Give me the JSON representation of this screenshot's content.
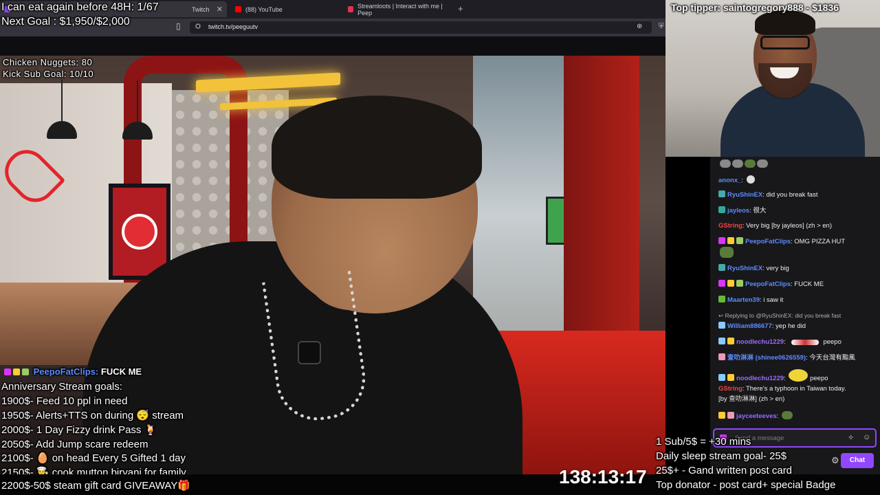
{
  "browser": {
    "tabs": [
      {
        "label": "Twitch",
        "active": true
      },
      {
        "label": "(88) YouTube",
        "active": false
      },
      {
        "label": "Streamloots | Interact with me | Peep",
        "active": false
      }
    ],
    "url": "twitch.tv/peeguutv",
    "icons": [
      "back-icon",
      "reload-icon",
      "bookmark-icon",
      "zoom-icon",
      "shield-icon"
    ]
  },
  "overlay": {
    "eat_again": "I can eat again before 48H: 1/67",
    "next_goal": "Next Goal : $1,950/$2,000",
    "chicken_nuggets": "Chicken Nuggets: 80",
    "kick_sub_goal": "Kick Sub Goal: 10/10",
    "top_tipper": "Top tipper: saintogregory888 - $1836",
    "alert_user": "PeepoFatClips:",
    "alert_message": "FUCK ME",
    "goals_title": "Anniversary Stream goals:",
    "goals": [
      "1900$- Feed 10 ppl in need",
      "1950$- Alerts+TTS on during 😴 stream",
      "2000$- 1 Day Fizzy drink Pass 🍹",
      "2050$- Add Jump scare redeem",
      "2100$- 🥚 on head Every 5 Gifted 1 day",
      "2150$- 👨‍🍳 cook mutton biryani for family",
      "2200$-50$ steam gift card GIVEAWAY🎁"
    ],
    "sub_rules": [
      "1 Sub/5$ = +30 mins",
      "Daily sleep stream goal- 25$",
      "25$+ - Gand written post card",
      "Top donator - post card+ special Badge"
    ],
    "timer": "138:13:17"
  },
  "chat": {
    "messages": [
      {
        "user": "anonx_",
        "user_color": "#5b8cff",
        "text": ""
      },
      {
        "user": "RyuShinEX",
        "user_color": "#5b8cff",
        "text": "did you break fast"
      },
      {
        "user": "jayleos",
        "user_color": "#5b8cff",
        "text": "很大"
      },
      {
        "user": "GString",
        "user_color": "#ff4040",
        "text": "Very big [by jayleos] (zh > en)"
      },
      {
        "user": "PeepoFatClips",
        "user_color": "#5b8cff",
        "text": "OMG PIZZA HUT"
      },
      {
        "user": "RyuShinEX",
        "user_color": "#5b8cff",
        "text": "very big"
      },
      {
        "user": "PeepoFatClips",
        "user_color": "#5b8cff",
        "text": "FUCK ME"
      },
      {
        "user": "Maarten39",
        "user_color": "#5b8cff",
        "text": "i saw it"
      },
      {
        "reply": "Replying to @RyuShinEX: did you break fast"
      },
      {
        "user": "William886677",
        "user_color": "#5b8cff",
        "text": "yep he did"
      },
      {
        "user": "noodlechu1229",
        "user_color": "#9b6bff",
        "text": "peepo"
      },
      {
        "user": "查叻淋淋 (shinee0626559)",
        "user_color": "#5b8cff",
        "text": "今天台灣有颱風"
      },
      {
        "user": "noodlechu1229",
        "user_color": "#9b6bff",
        "text": "peepo"
      },
      {
        "user": "GString",
        "user_color": "#ff4040",
        "text": "There's a typhoon in Taiwan today."
      },
      {
        "cont": "[by 查叻淋淋] (zh > en)"
      },
      {
        "user": "jayceeteeves",
        "user_color": "#9b6bff",
        "text": ""
      }
    ],
    "input_placeholder": "Send a message",
    "chat_button": "Chat"
  }
}
